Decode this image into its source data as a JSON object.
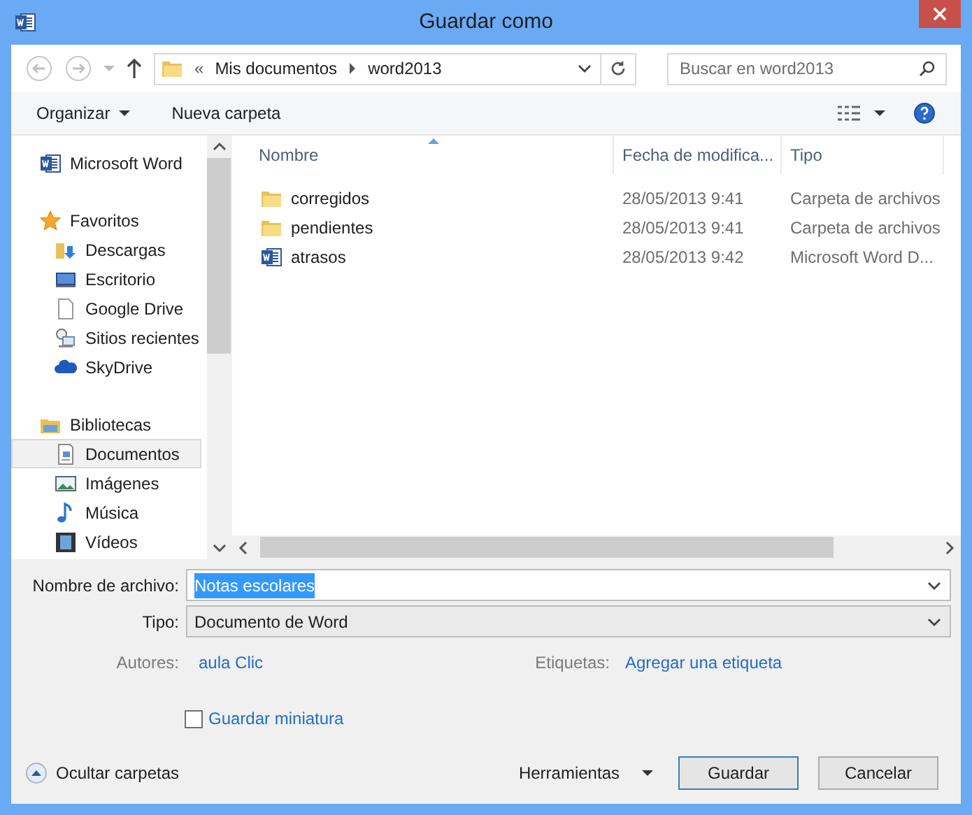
{
  "window": {
    "title": "Guardar como"
  },
  "address": {
    "crumbs": [
      "Mis documentos",
      "word2013"
    ],
    "overflow": "«"
  },
  "search": {
    "placeholder": "Buscar en word2013"
  },
  "toolbar": {
    "organize": "Organizar",
    "new_folder": "Nueva carpeta"
  },
  "sidebar": {
    "items": [
      {
        "label": "Microsoft Word",
        "kind": "word",
        "selected": false
      },
      {
        "label": "Favoritos",
        "kind": "star",
        "selected": false,
        "children": [
          {
            "label": "Descargas",
            "kind": "downloads",
            "selected": false
          },
          {
            "label": "Escritorio",
            "kind": "desktop",
            "selected": false
          },
          {
            "label": "Google Drive",
            "kind": "page",
            "selected": false
          },
          {
            "label": "Sitios recientes",
            "kind": "recent",
            "selected": false
          },
          {
            "label": "SkyDrive",
            "kind": "cloud",
            "selected": false
          }
        ]
      },
      {
        "label": "Bibliotecas",
        "kind": "library",
        "selected": false,
        "children": [
          {
            "label": "Documentos",
            "kind": "document",
            "selected": true
          },
          {
            "label": "Imágenes",
            "kind": "image",
            "selected": false
          },
          {
            "label": "Música",
            "kind": "music",
            "selected": false
          },
          {
            "label": "Vídeos",
            "kind": "video",
            "selected": false
          }
        ]
      }
    ]
  },
  "table": {
    "columns": [
      "Nombre",
      "Fecha de modifica...",
      "Tipo"
    ],
    "rows": [
      {
        "kind": "folder",
        "name": "corregidos",
        "date": "28/05/2013 9:41",
        "type": "Carpeta de archivos"
      },
      {
        "kind": "folder",
        "name": "pendientes",
        "date": "28/05/2013 9:41",
        "type": "Carpeta de archivos"
      },
      {
        "kind": "word",
        "name": "atrasos",
        "date": "28/05/2013 9:42",
        "type": "Microsoft Word D..."
      }
    ]
  },
  "form": {
    "filename_label": "Nombre de archivo:",
    "filename": "Notas escolares",
    "type_label": "Tipo:",
    "type": "Documento de Word",
    "authors_label": "Autores:",
    "authors": "aula Clic",
    "tags_label": "Etiquetas:",
    "tags": "Agregar una etiqueta",
    "thumbnail": {
      "label": "Guardar miniatura",
      "checked": false
    }
  },
  "footer": {
    "hide_folders": "Ocultar carpetas",
    "tools": "Herramientas",
    "save": "Guardar",
    "cancel": "Cancelar"
  }
}
